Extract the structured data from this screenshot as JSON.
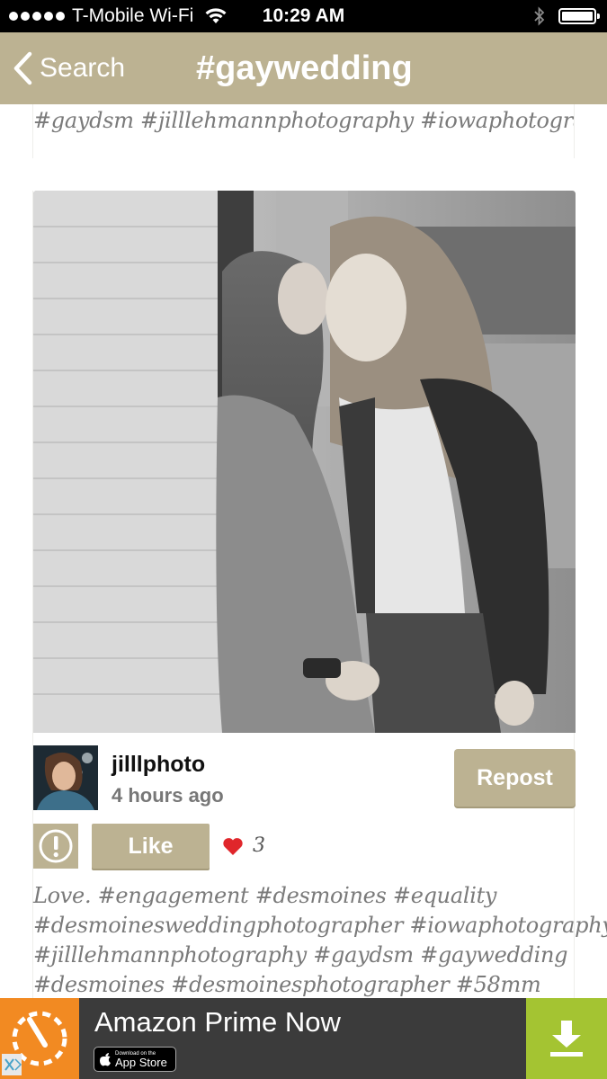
{
  "status_bar": {
    "carrier": "T-Mobile Wi-Fi",
    "time": "10:29 AM",
    "icons": [
      "signal-dots-icon",
      "wifi-icon",
      "bluetooth-icon",
      "battery-icon"
    ]
  },
  "nav": {
    "back_label": "Search",
    "title": "#gaywedding",
    "bar_color": "#bcb292"
  },
  "previous_post": {
    "caption_tail": "#gaydsm #jilllehmannphotography #iowaphotography"
  },
  "post": {
    "username": "jilllphoto",
    "time_ago": "4 hours ago",
    "repost_label": "Repost",
    "like_label": "Like",
    "like_count": "3",
    "caption_lines": [
      "Love.  #engagement #desmoines #equality",
      "#desmoinesweddingphotographer #iowaphotography",
      "#jilllehmannphotography #gaydsm #gaywedding",
      "#desmoines #desmoinesphotographer #58mm"
    ],
    "icons": [
      "report-icon",
      "heart-icon"
    ],
    "heart_color": "#e0262b"
  },
  "ad": {
    "title": "Amazon Prime Now",
    "badge_small": "Download on the",
    "badge_big": "App Store",
    "icons": [
      "prime-now-icon",
      "apple-icon",
      "download-icon",
      "close-icon"
    ],
    "accent_color": "#a4c432",
    "icon_color": "#f28a22"
  }
}
